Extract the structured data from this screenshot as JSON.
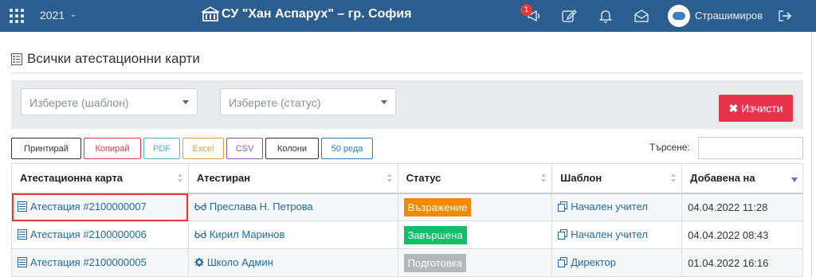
{
  "header": {
    "year": "2021",
    "school_title": "СУ \"Хан Аспарух\" – гр. София",
    "notification_count": "1",
    "user_name": "Страшимиров"
  },
  "page": {
    "title": "Всички атестационни карти"
  },
  "filters": {
    "template_placeholder": "Изберете (шаблон)",
    "status_placeholder": "Изберете (статус)",
    "clear_label": "Изчисти"
  },
  "toolbar": {
    "buttons": [
      {
        "label": "Принтирай",
        "color": "#333333"
      },
      {
        "label": "Копирай",
        "color": "#e8334d"
      },
      {
        "label": "PDF",
        "color": "#4fb3c9"
      },
      {
        "label": "Excel",
        "color": "#d8a23c"
      },
      {
        "label": "CSV",
        "color": "#8e5aa8"
      },
      {
        "label": "Колони",
        "color": "#333333"
      },
      {
        "label": "50 реда",
        "color": "#2b7fbf"
      }
    ],
    "search_label": "Търсене:"
  },
  "table": {
    "headers": [
      "Атестационна карта",
      "Атестиран",
      "Статус",
      "Шаблон",
      "Добавена на"
    ],
    "rows": [
      {
        "card": "Атестация #2100000007",
        "person": "Преслава Н. Петрова",
        "person_icon": "glasses-icon",
        "status": "Възражение",
        "status_color": "#f08a00",
        "template": "Начален учител",
        "date": "04.04.2022 11:28"
      },
      {
        "card": "Атестация #2100000006",
        "person": "Кирил Маринов",
        "person_icon": "glasses-icon",
        "status": "Завършена",
        "status_color": "#0fbf6a",
        "template": "Начален учител",
        "date": "04.04.2022 08:43"
      },
      {
        "card": "Атестация #2100000005",
        "person": "Школо Админ",
        "person_icon": "gear-icon",
        "status": "Подготовка",
        "status_color": "#b3b8bd",
        "template": "Директор",
        "date": "01.04.2022 16:16"
      }
    ]
  }
}
